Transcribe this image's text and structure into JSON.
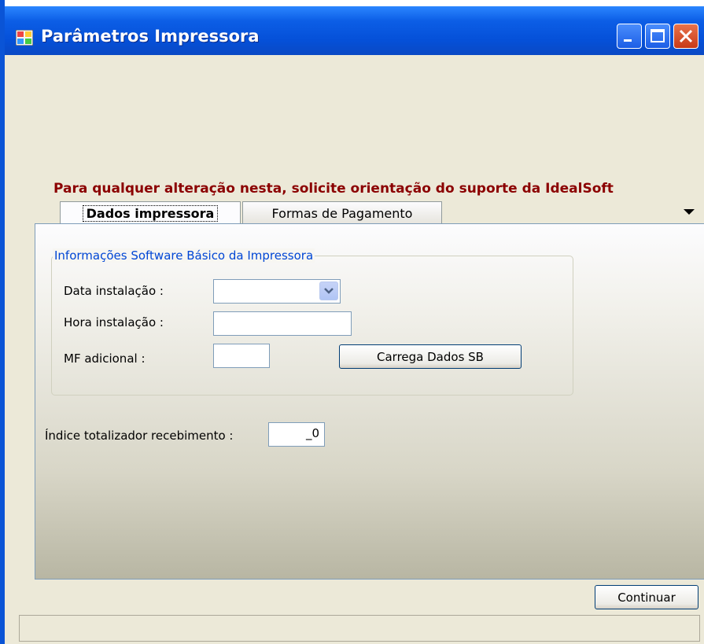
{
  "window": {
    "title": "Parâmetros Impressora",
    "title_bar_color": "#0c5ee6",
    "buttons": {
      "minimize": "minimize-icon",
      "maximize": "maximize-icon",
      "close": "close-icon"
    }
  },
  "warning_text": "Para qualquer alteração nesta, solicite orientação do suporte da IdealSoft",
  "tabs": [
    {
      "label": "Dados impressora",
      "active": true
    },
    {
      "label": "Formas de Pagamento",
      "active": false
    }
  ],
  "group": {
    "title": "Informações Software Básico da Impressora",
    "data_instalacao_label": "Data instalação :",
    "data_instalacao_value": "",
    "hora_instalacao_label": "Hora instalação :",
    "hora_instalacao_value": "",
    "mf_adicional_label": "MF adicional :",
    "mf_adicional_value": "",
    "carrega_button": "Carrega Dados SB"
  },
  "indice": {
    "label": "Índice totalizador recebimento :",
    "value": "_0"
  },
  "continuar_button": "Continuar",
  "colors": {
    "warning": "#8b0000",
    "group_title": "#0046d5",
    "window_bg": "#ece9d8"
  }
}
